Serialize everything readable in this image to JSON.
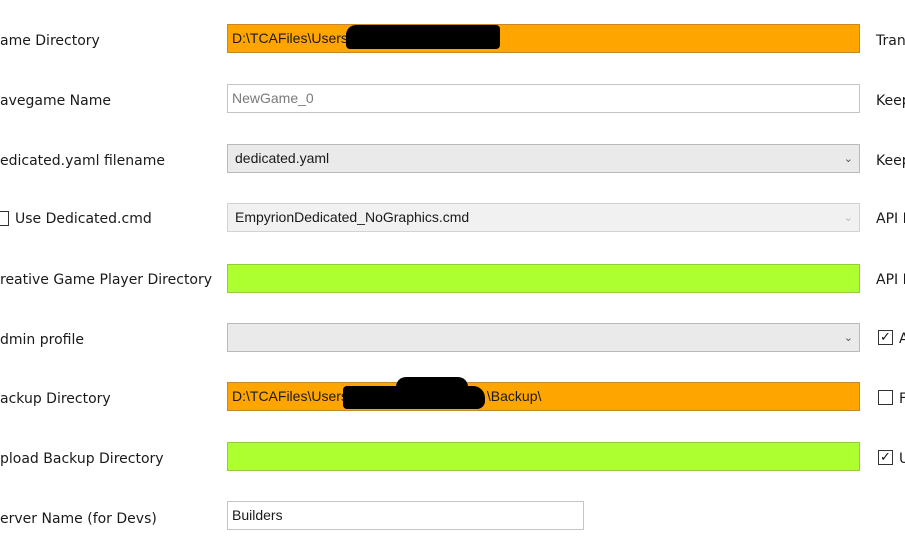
{
  "labels": {
    "game_dir": "ame Directory",
    "savegame": "avegame Name",
    "dedicated_yaml": "edicated.yaml filename",
    "use_dedicated": "Use Dedicated.cmd",
    "creative": "reative Game Player Directory",
    "admin": "dmin profile",
    "backup": "ackup Directory",
    "upload": "pload Backup Directory",
    "server_name": "erver Name (for Devs)"
  },
  "fields": {
    "game_dir_value": "D:\\TCAFiles\\Users",
    "savegame_placeholder": "NewGame_0",
    "dedicated_yaml_value": "dedicated.yaml",
    "dedicated_cmd_value": "EmpyrionDedicated_NoGraphics.cmd",
    "admin_value": "",
    "backup_value_start": "D:\\TCAFiles\\Users",
    "backup_value_end": "\\Backup\\",
    "server_name_value": "Builders"
  },
  "right_labels": {
    "r1": "Trans",
    "r2": "Keep",
    "r3": "Keep",
    "r4": "API I",
    "r5": "API F",
    "r6": "A",
    "r7": "F",
    "r8": "U"
  },
  "icons": {
    "check": "✓",
    "chevron": "⌄"
  },
  "checkboxes": {
    "use_dedicated": false,
    "right_a": true,
    "right_f": false,
    "right_u": true
  },
  "colors": {
    "orange": "#ffa500",
    "green": "#adff2f"
  }
}
